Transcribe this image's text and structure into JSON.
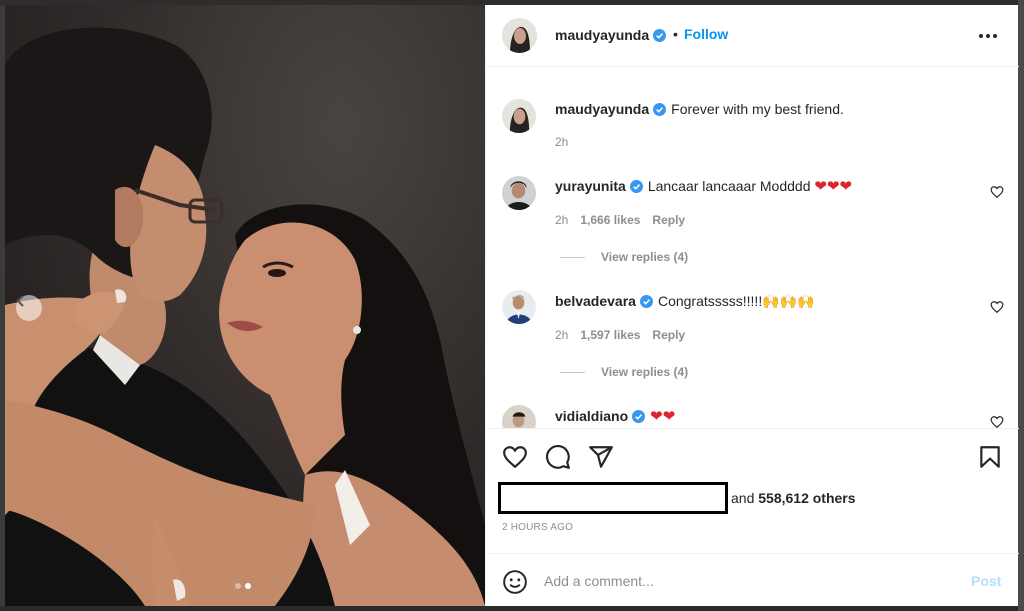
{
  "post": {
    "author": "maudyayunda",
    "follow_label": "Follow",
    "separator": "•",
    "caption": "Forever with my best friend.",
    "caption_time": "2h",
    "carousel": {
      "slide_count": 2,
      "active_slide": 2
    }
  },
  "comments": [
    {
      "user": "yurayunita",
      "verified": true,
      "text": "Lancaar lancaaar Modddd",
      "emojis": "❤❤❤",
      "time": "2h",
      "likes": "1,666 likes",
      "reply_label": "Reply",
      "view_replies": "View replies (4)"
    },
    {
      "user": "belvadevara",
      "verified": true,
      "text": "Congratsssss!!!!!",
      "emojis": "🙌🙌🙌",
      "time": "2h",
      "likes": "1,597 likes",
      "reply_label": "Reply",
      "view_replies": "View replies (4)"
    },
    {
      "user": "vidialdiano",
      "verified": true,
      "text": "",
      "emojis": "❤❤"
    }
  ],
  "actions": {
    "likes_suffix_prefix": "and",
    "likes_count": "558,612 others",
    "timestamp": "2 HOURS AGO"
  },
  "add_comment": {
    "placeholder": "Add a comment...",
    "post_label": "Post"
  },
  "icons": {
    "like": "heart-outline-icon",
    "comment": "speech-bubble-icon",
    "share": "paper-plane-icon",
    "save": "bookmark-icon",
    "emoji": "smiley-icon",
    "more": "three-dots-icon",
    "verified": "verified-badge-icon",
    "carousel_prev": "chevron-left-icon"
  },
  "colors": {
    "accent": "#0095f6",
    "post_disabled": "#b2dffc",
    "muted_text": "#8e8e8e",
    "verified": "#3897f0",
    "heart_emoji": "#e0212e"
  }
}
